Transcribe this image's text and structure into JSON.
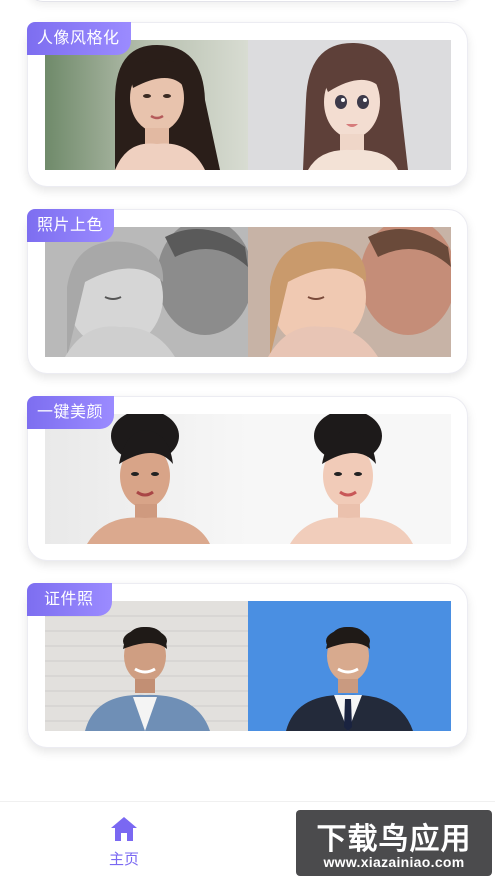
{
  "cards": [
    {
      "label": "人像风格化",
      "before": "portrait-woman-photo",
      "after": "portrait-woman-cartoon"
    },
    {
      "label": "照片上色",
      "before": "father-child-grayscale",
      "after": "father-child-colorized"
    },
    {
      "label": "一键美颜",
      "before": "woman-original",
      "after": "woman-beautified"
    },
    {
      "label": "证件照",
      "before": "man-brick-wall",
      "after": "man-blue-background-suit"
    }
  ],
  "nav": {
    "home_label": "主页",
    "home_icon": "home-icon",
    "accent": "#7a68f2"
  },
  "watermark": {
    "title": "下载鸟应用",
    "url": "www.xiazainiao.com"
  }
}
